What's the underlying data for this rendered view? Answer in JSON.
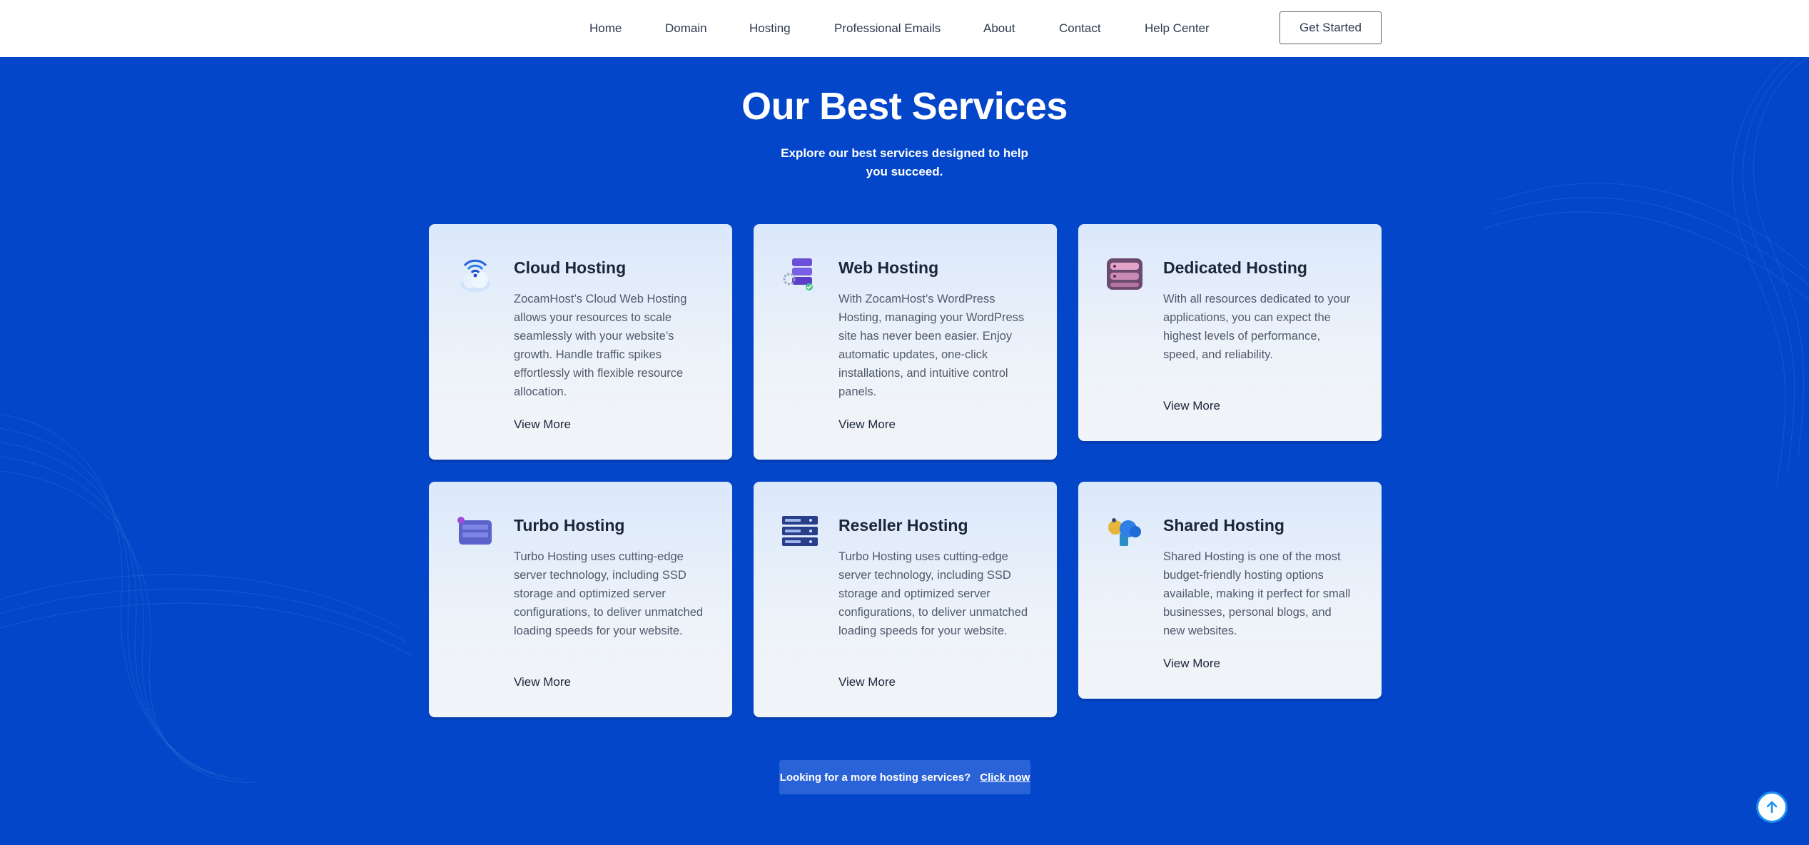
{
  "nav": {
    "links": [
      "Home",
      "Domain",
      "Hosting",
      "Professional Emails",
      "About",
      "Contact",
      "Help Center"
    ],
    "cta": "Get Started"
  },
  "hero": {
    "title": "Our Best Services",
    "subtitle": "Explore our best services designed to help you succeed."
  },
  "services": [
    {
      "icon": "cloud-wifi-icon",
      "title": "Cloud Hosting",
      "description": "ZocamHost’s Cloud Web Hosting allows your resources to scale seamlessly with your website’s growth. Handle traffic spikes effortlessly with flexible resource allocation.",
      "link": "View More"
    },
    {
      "icon": "server-stack-icon",
      "title": "Web Hosting",
      "description": "With ZocamHost’s WordPress Hosting, managing your WordPress site has never been easier. Enjoy automatic updates, one-click installations, and intuitive control panels.",
      "link": "View More"
    },
    {
      "icon": "server-rack-icon",
      "title": "Dedicated Hosting",
      "description": "With all resources dedicated to your applications, you can expect the highest levels of performance, speed, and reliability.",
      "link": "View More"
    },
    {
      "icon": "turbo-server-icon",
      "title": "Turbo Hosting",
      "description": "Turbo Hosting uses cutting-edge server technology, including SSD storage and optimized server configurations, to deliver unmatched loading speeds for your website.",
      "link": "View More"
    },
    {
      "icon": "reseller-server-icon",
      "title": "Reseller Hosting",
      "description": "Turbo Hosting uses cutting-edge server technology, including SSD storage and optimized server configurations, to deliver unmatched loading speeds for your website.",
      "link": "View More"
    },
    {
      "icon": "shared-cloud-icon",
      "title": "Shared Hosting",
      "description": "Shared Hosting is one of the most budget-friendly hosting options available, making it perfect for small businesses, personal blogs, and new websites.",
      "link": "View More"
    }
  ],
  "more": {
    "text": "Looking for a more hosting services?",
    "link": "Click now"
  },
  "colors": {
    "background": "#0346c9",
    "nav_background": "#ffffff",
    "card_top": "#dbe8fb",
    "card_bottom": "#f1f4f8",
    "scroll_top_ring": "#1b8ef0"
  },
  "scroll_top": {
    "icon": "arrow-up-icon"
  }
}
